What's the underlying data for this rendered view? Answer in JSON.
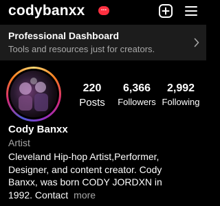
{
  "header": {
    "username": "codybanxx",
    "notification_badge": "...",
    "icons": [
      "plus-square-icon",
      "hamburger-menu-icon"
    ]
  },
  "dashboard": {
    "title": "Professional Dashboard",
    "subtitle": "Tools and resources just for creators."
  },
  "stats": [
    {
      "value": "220",
      "label": "Posts"
    },
    {
      "value": "6,366",
      "label": "Followers"
    },
    {
      "value": "2,992",
      "label": "Following"
    }
  ],
  "profile": {
    "name": "Cody Banxx",
    "category": "Artist",
    "bio_lines": [
      "Cleveland Hip-hop Artist,Performer,",
      "Designer, and content creator. Cody",
      "Banxx, was born CODY JORDXN in",
      "1992. Contact"
    ],
    "more_label": "more"
  },
  "colors": {
    "background": "#000000",
    "notification": "#ff3040",
    "secondary_text": "#a8a8a8",
    "dashboard_bg": "#1c1c1c"
  }
}
